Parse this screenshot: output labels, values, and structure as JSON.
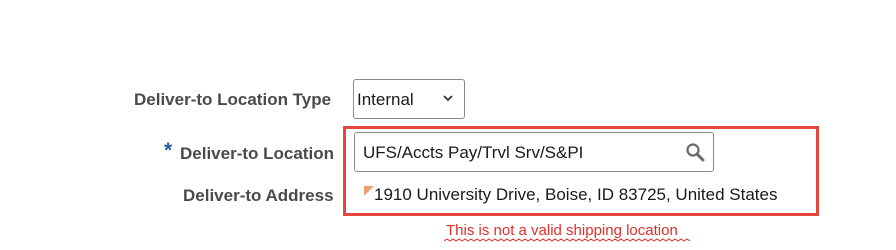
{
  "form": {
    "location_type": {
      "label": "Deliver-to Location Type",
      "selected_value": "Internal"
    },
    "location": {
      "required_marker": "*",
      "label": "Deliver-to Location",
      "value": "UFS/Accts Pay/Trvl Srv/S&PI",
      "search_icon": "search-icon"
    },
    "address": {
      "label": "Deliver-to Address",
      "value": "1910 University Drive, Boise, ID 83725, United States"
    },
    "error_message": "This is not a valid shipping location"
  },
  "colors": {
    "highlight": "#e8453c",
    "error": "#e0302a",
    "required": "#2a5aa3",
    "flag": "#f0a070"
  }
}
